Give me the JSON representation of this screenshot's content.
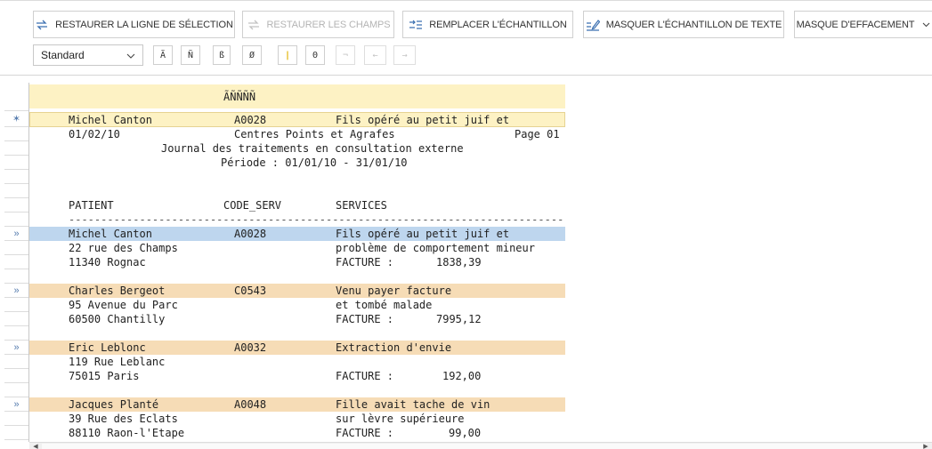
{
  "toolbar": {
    "restore_selection_label": "RESTAURER LA LIGNE DE SÉLECTION",
    "restore_fields_label": "RESTAURER LES CHAMPS",
    "replace_sample_label": "REMPLACER L'ÉCHANTILLON",
    "mask_text_label": "MASQUER L'ÉCHANTILLON DE TEXTE",
    "erase_mask_label": "MASQUE D'EFFACEMENT"
  },
  "format": {
    "selected": "Standard",
    "chars": [
      "Ã",
      "Ñ",
      "ß",
      "Ø",
      "|",
      "Θ",
      "¬",
      "←",
      "→"
    ]
  },
  "gutter": {
    "row_marker": "»",
    "sample_marker": "✶"
  },
  "sample": {
    "field_header": "ÃÑÑÑÑ",
    "name": "Michel Canton",
    "code": "A0028",
    "service": "Fils opéré au petit juif et"
  },
  "report": {
    "date": "01/02/10",
    "company": "Centres Points et Agrafes",
    "page": "Page 01",
    "title": "Journal des traitements en consultation externe",
    "period": "Période : 01/01/10 - 31/01/10",
    "col_patient": "PATIENT",
    "col_code": "CODE_SERV",
    "col_services": "SERVICES",
    "separator": "-----------------------------------------------------------------------------",
    "invoice_label": "FACTURE :",
    "records": [
      {
        "name": "Michel Canton",
        "code": "A0028",
        "address": "22 rue des Champs",
        "city": "11340 Rognac",
        "service1": "Fils opéré au petit juif et",
        "service2": "problème de comportement mineur",
        "amount": "1838,39"
      },
      {
        "name": "Charles Bergeot",
        "code": "C0543",
        "address": "95 Avenue du Parc",
        "city": "60500 Chantilly",
        "service1": "Venu payer facture",
        "service2": "et tombé malade",
        "amount": "7995,12"
      },
      {
        "name": "Eric Leblonc",
        "code": "A0032",
        "address": "119 Rue Leblanc",
        "city": "75015 Paris",
        "service1": "Extraction d'envie",
        "service2": "",
        "amount": "192,00"
      },
      {
        "name": "Jacques Planté",
        "code": "A0048",
        "address": "39 Rue des Eclats",
        "city": "88110 Raon-l'Etape",
        "service1": "Fille avait tache de vin",
        "service2": "sur lèvre supérieure",
        "amount": "99,00"
      }
    ]
  },
  "scrollbar": {
    "left_arrow": "◀",
    "right_arrow": "▶"
  },
  "colors": {
    "sample_row": "#fdf2c4",
    "record_row": "#f6dcb6",
    "selected_row": "#bed6ee"
  }
}
